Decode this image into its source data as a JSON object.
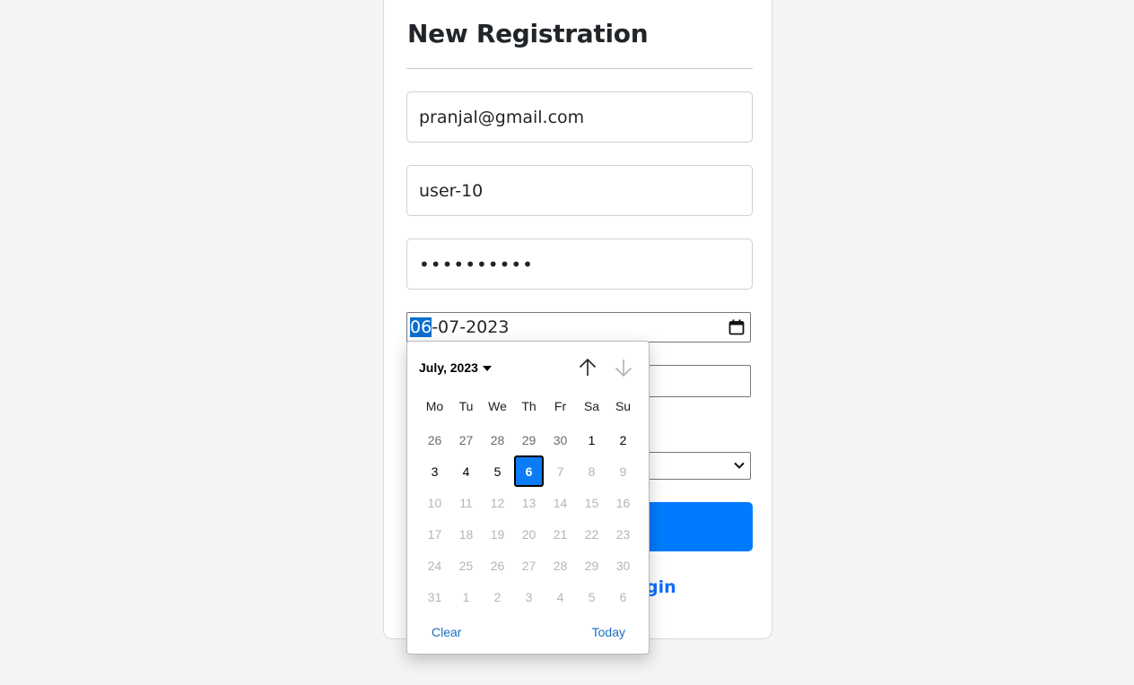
{
  "form": {
    "title": "New Registration",
    "email_value": "pranjal@gmail.com",
    "username_value": "user-10",
    "password_mask": "••••••••••",
    "date_day": "06",
    "date_rest": "-07-2023",
    "link_partial": "gin"
  },
  "calendar": {
    "month_label": "July, 2023",
    "weekdays": [
      "Mo",
      "Tu",
      "We",
      "Th",
      "Fr",
      "Sa",
      "Su"
    ],
    "weeks": [
      [
        {
          "d": "26",
          "s": "other"
        },
        {
          "d": "27",
          "s": "other"
        },
        {
          "d": "28",
          "s": "other"
        },
        {
          "d": "29",
          "s": "other"
        },
        {
          "d": "30",
          "s": "other"
        },
        {
          "d": "1",
          "s": "cur"
        },
        {
          "d": "2",
          "s": "cur"
        }
      ],
      [
        {
          "d": "3",
          "s": "cur"
        },
        {
          "d": "4",
          "s": "cur"
        },
        {
          "d": "5",
          "s": "cur"
        },
        {
          "d": "6",
          "s": "sel"
        },
        {
          "d": "7",
          "s": "dis"
        },
        {
          "d": "8",
          "s": "dis"
        },
        {
          "d": "9",
          "s": "dis"
        }
      ],
      [
        {
          "d": "10",
          "s": "dis"
        },
        {
          "d": "11",
          "s": "dis"
        },
        {
          "d": "12",
          "s": "dis"
        },
        {
          "d": "13",
          "s": "dis"
        },
        {
          "d": "14",
          "s": "dis"
        },
        {
          "d": "15",
          "s": "dis"
        },
        {
          "d": "16",
          "s": "dis"
        }
      ],
      [
        {
          "d": "17",
          "s": "dis"
        },
        {
          "d": "18",
          "s": "dis"
        },
        {
          "d": "19",
          "s": "dis"
        },
        {
          "d": "20",
          "s": "dis"
        },
        {
          "d": "21",
          "s": "dis"
        },
        {
          "d": "22",
          "s": "dis"
        },
        {
          "d": "23",
          "s": "dis"
        }
      ],
      [
        {
          "d": "24",
          "s": "dis"
        },
        {
          "d": "25",
          "s": "dis"
        },
        {
          "d": "26",
          "s": "dis"
        },
        {
          "d": "27",
          "s": "dis"
        },
        {
          "d": "28",
          "s": "dis"
        },
        {
          "d": "29",
          "s": "dis"
        },
        {
          "d": "30",
          "s": "dis"
        }
      ],
      [
        {
          "d": "31",
          "s": "dis"
        },
        {
          "d": "1",
          "s": "dis"
        },
        {
          "d": "2",
          "s": "dis"
        },
        {
          "d": "3",
          "s": "dis"
        },
        {
          "d": "4",
          "s": "dis"
        },
        {
          "d": "5",
          "s": "dis"
        },
        {
          "d": "6",
          "s": "dis"
        }
      ]
    ],
    "clear_label": "Clear",
    "today_label": "Today"
  },
  "icons": {
    "calendar": "calendar-icon",
    "prev": "arrow-up-icon",
    "next": "arrow-down-icon",
    "dropdown": "caret-down-icon",
    "select": "chevron-down-icon"
  },
  "colors": {
    "primary": "#007bff",
    "selected_day": "#0a7cf5",
    "link": "#1b6fc2"
  }
}
